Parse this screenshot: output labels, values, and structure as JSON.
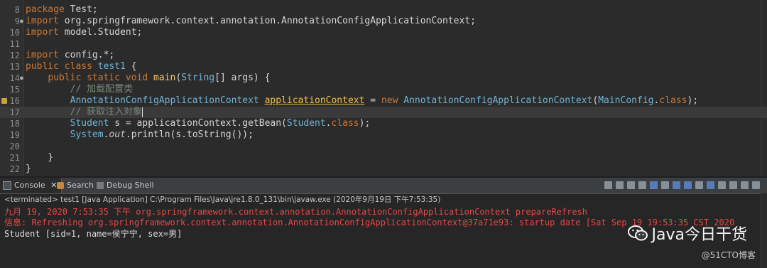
{
  "editor": {
    "lines": [
      {
        "n": "8",
        "segments": [
          [
            "kw",
            "package"
          ],
          [
            "plain",
            " Test;"
          ]
        ]
      },
      {
        "n": "9",
        "fold": true,
        "segments": [
          [
            "kw",
            "import"
          ],
          [
            "plain",
            " org.springframework.context.annotation.AnnotationConfigApplicationContext;"
          ]
        ]
      },
      {
        "n": "10",
        "segments": [
          [
            "kw",
            "import"
          ],
          [
            "plain",
            " model.Student;"
          ]
        ]
      },
      {
        "n": "11",
        "segments": []
      },
      {
        "n": "12",
        "segments": [
          [
            "kw",
            "import"
          ],
          [
            "plain",
            " config.*;"
          ]
        ]
      },
      {
        "n": "13",
        "segments": [
          [
            "kw",
            "public class"
          ],
          [
            "type",
            " test1"
          ],
          [
            "plain",
            " {"
          ]
        ]
      },
      {
        "n": "14",
        "fold": true,
        "segments": [
          [
            "plain",
            "    "
          ],
          [
            "kw",
            "public static void"
          ],
          [
            "method",
            " main"
          ],
          [
            "plain",
            "("
          ],
          [
            "type",
            "String"
          ],
          [
            "plain",
            "[] args) {"
          ]
        ]
      },
      {
        "n": "15",
        "segments": [
          [
            "plain",
            "        "
          ],
          [
            "comment",
            "// 加载配置类"
          ]
        ]
      },
      {
        "n": "16",
        "marker": true,
        "segments": [
          [
            "plain",
            "        "
          ],
          [
            "type",
            "AnnotationConfigApplicationContext"
          ],
          [
            "plain",
            " "
          ],
          [
            "varul",
            "applicationContext"
          ],
          [
            "plain",
            " = "
          ],
          [
            "kw",
            "new"
          ],
          [
            "type",
            " AnnotationConfigApplicationContext"
          ],
          [
            "plain",
            "("
          ],
          [
            "type",
            "MainConfig"
          ],
          [
            "plain",
            "."
          ],
          [
            "kw",
            "class"
          ],
          [
            "plain",
            ");"
          ]
        ]
      },
      {
        "n": "17",
        "current": true,
        "segments": [
          [
            "plain",
            "        "
          ],
          [
            "comment",
            "// 获取注入对象"
          ]
        ],
        "cursor": true
      },
      {
        "n": "18",
        "segments": [
          [
            "plain",
            "        "
          ],
          [
            "type",
            "Student"
          ],
          [
            "plain",
            " s = applicationContext.getBean("
          ],
          [
            "type",
            "Student"
          ],
          [
            "plain",
            "."
          ],
          [
            "kw",
            "class"
          ],
          [
            "plain",
            ");"
          ]
        ]
      },
      {
        "n": "19",
        "segments": [
          [
            "plain",
            "        "
          ],
          [
            "type",
            "System"
          ],
          [
            "plain",
            "."
          ],
          [
            "field-i",
            "out"
          ],
          [
            "plain",
            ".println(s.toString());"
          ]
        ]
      },
      {
        "n": "20",
        "segments": []
      },
      {
        "n": "21",
        "segments": [
          [
            "plain",
            "    }"
          ]
        ]
      },
      {
        "n": "22",
        "segments": [
          [
            "plain",
            "}"
          ]
        ]
      }
    ]
  },
  "console": {
    "tabs": {
      "console": "Console",
      "search": "Search",
      "debug_shell": "Debug Shell"
    },
    "terminated": "<terminated> test1 [Java Application] C:\\Program Files\\Java\\jre1.8.0_131\\bin\\javaw.exe (2020年9月19日 下午7:53:35)",
    "output": [
      {
        "kind": "err",
        "text": "九月 19, 2020 7:53:35 下午 org.springframework.context.annotation.AnnotationConfigApplicationContext prepareRefresh"
      },
      {
        "kind": "err",
        "text": "信息: Refreshing org.springframework.context.annotation.AnnotationConfigApplicationContext@37a71e93: startup date [Sat Sep 19 19:53:35 CST 2020"
      },
      {
        "kind": "std",
        "text": "Student [sid=1, name=侯宁宁, sex=男]"
      }
    ]
  },
  "watermark": {
    "brand": "Java今日干货",
    "sub": "@51CTO博客"
  },
  "colors": {
    "editor_bg": "#2b2b2b",
    "keyword": "#cc7832",
    "type": "#6fb5d6",
    "error_text": "#e84646"
  }
}
